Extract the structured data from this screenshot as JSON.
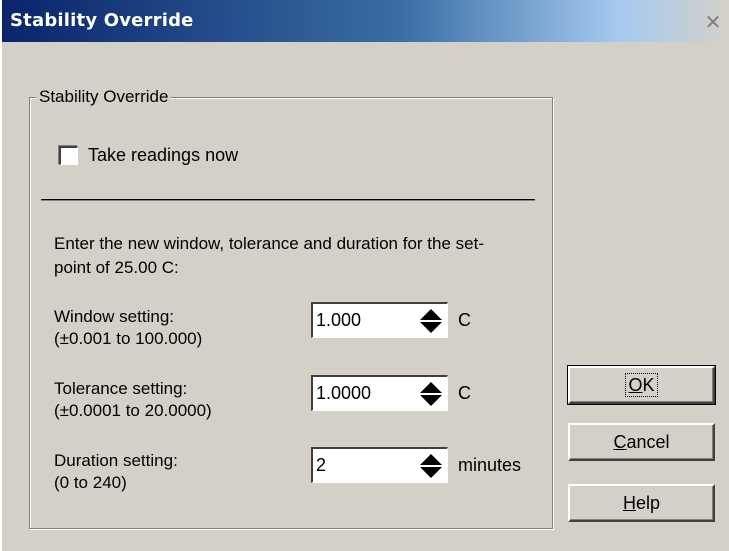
{
  "window": {
    "title": "Stability Override",
    "close_glyph": "✕"
  },
  "group": {
    "legend": "Stability Override",
    "checkbox_label": "Take readings now",
    "checkbox_checked": false,
    "instruction": "Enter the new window, tolerance and duration for the set-point of 25.00 C:"
  },
  "fields": [
    {
      "label_line1": "Window setting:",
      "label_line2": "(±0.001 to 100.000)",
      "value": "1.000",
      "unit": "C"
    },
    {
      "label_line1": "Tolerance setting:",
      "label_line2": "(±0.0001 to 20.0000)",
      "value": "1.0000",
      "unit": "C"
    },
    {
      "label_line1": "Duration setting:",
      "label_line2": "(0 to 240)",
      "value": "2",
      "unit": "minutes"
    }
  ],
  "buttons": {
    "ok": {
      "mnemonic": "O",
      "rest": "K"
    },
    "cancel": {
      "mnemonic": "C",
      "rest": "ancel"
    },
    "help": {
      "mnemonic": "H",
      "rest": "elp"
    }
  },
  "colors": {
    "title_gradient_start": "#0a246a",
    "title_gradient_end": "#a6caf0",
    "dialog_face": "#d4d0c8"
  }
}
